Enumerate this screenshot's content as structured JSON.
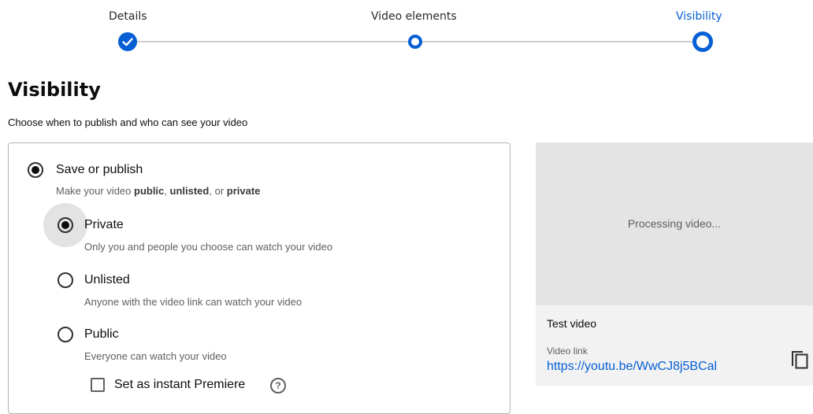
{
  "stepper": {
    "steps": [
      {
        "label": "Details",
        "state": "done"
      },
      {
        "label": "Video elements",
        "state": "visited"
      },
      {
        "label": "Visibility",
        "state": "current"
      }
    ]
  },
  "page": {
    "title": "Visibility",
    "subtitle": "Choose when to publish and who can see your video"
  },
  "options": {
    "save_publish": {
      "label": "Save or publish",
      "desc_prefix": "Make your video ",
      "desc_public": "public",
      "desc_sep1": ", ",
      "desc_unlisted": "unlisted",
      "desc_sep2": ", or ",
      "desc_private": "private",
      "selected": true
    },
    "private": {
      "label": "Private",
      "desc": "Only you and people you choose can watch your video",
      "selected": true
    },
    "unlisted": {
      "label": "Unlisted",
      "desc": "Anyone with the video link can watch your video",
      "selected": false
    },
    "public": {
      "label": "Public",
      "desc": "Everyone can watch your video",
      "selected": false
    },
    "premiere": {
      "label": "Set as instant Premiere",
      "checked": false,
      "help_glyph": "?"
    }
  },
  "preview": {
    "status": "Processing video...",
    "video_title": "Test video",
    "link_label": "Video link",
    "link": "https://youtu.be/WwCJ8j5BCal",
    "copy_icon": "copy-icon"
  },
  "colors": {
    "accent": "#065fd4",
    "text": "#0d0d0d",
    "secondary_text": "#606060"
  }
}
